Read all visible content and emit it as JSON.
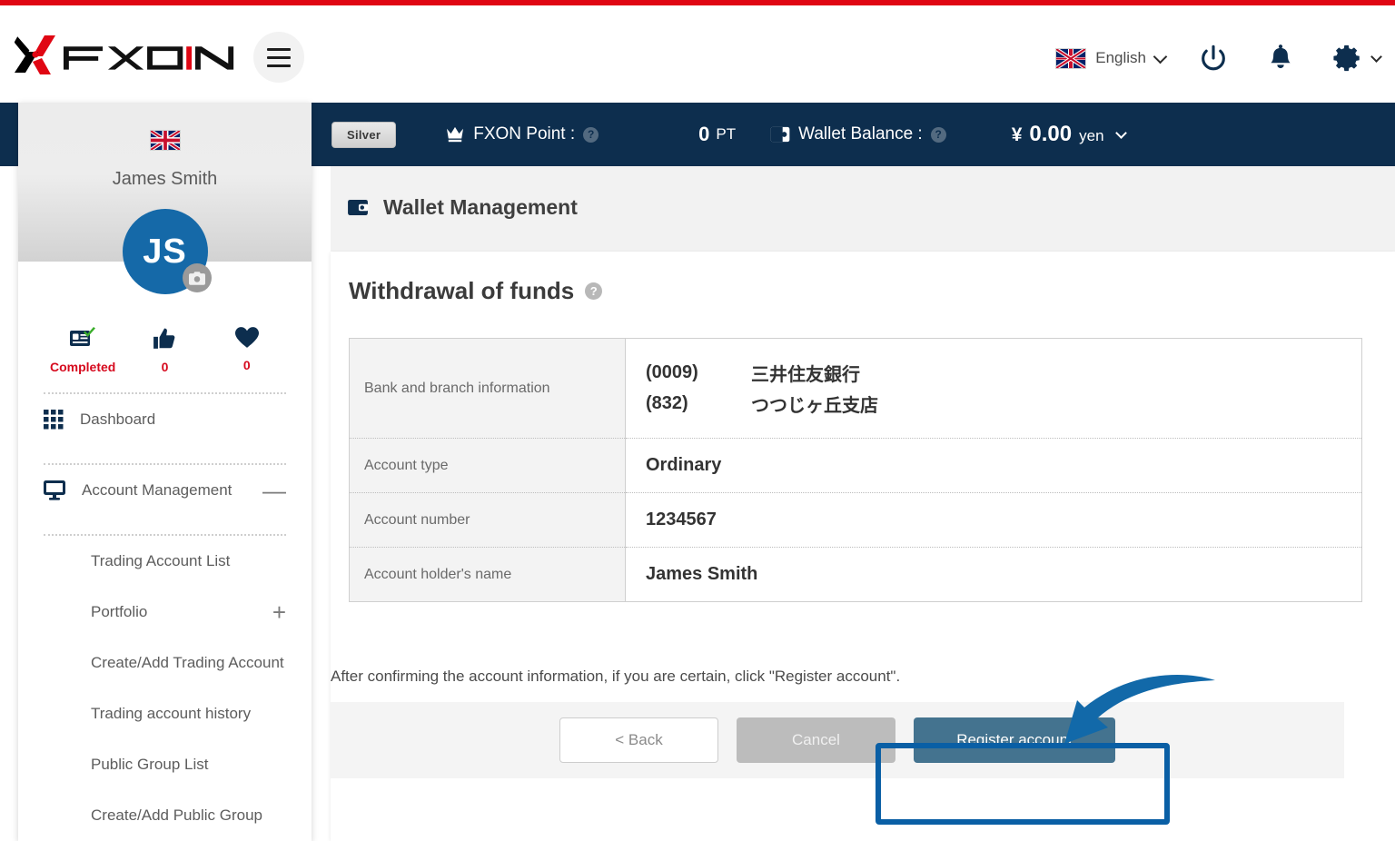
{
  "brand": {
    "logo_text": "FXON",
    "accent_red": "#e00613",
    "navy": "#0d2e4e"
  },
  "header": {
    "menu_icon": "hamburger-icon",
    "language": {
      "label": "English",
      "flag": "uk-flag-icon",
      "chevron": "chevron-down-icon"
    },
    "power_icon": "power-icon",
    "notification_icon": "bell-icon",
    "settings_icon": "gear-icon",
    "settings_chevron": "chevron-down-icon"
  },
  "status_bar": {
    "tier_badge": "Silver",
    "point_icon": "crown-icon",
    "point_label": "FXON Point :",
    "point_help": "?",
    "point_value": "0",
    "point_unit": "PT",
    "wallet_icon": "wallet-icon",
    "wallet_label": "Wallet Balance :",
    "wallet_help": "?",
    "currency_symbol": "¥",
    "balance_value": "0.00",
    "balance_unit": "yen",
    "balance_chevron": "chevron-down-icon"
  },
  "sidebar": {
    "flag": "uk-flag-icon",
    "user_name": "James Smith",
    "avatar_initials": "JS",
    "camera_icon": "camera-icon",
    "stats": [
      {
        "icon": "id-card-check-icon",
        "label": "Completed"
      },
      {
        "icon": "thumbs-up-icon",
        "label": "0"
      },
      {
        "icon": "heart-icon",
        "label": "0"
      }
    ],
    "nav": [
      {
        "icon": "grid-icon",
        "label": "Dashboard",
        "toggle": ""
      },
      {
        "icon": "monitor-icon",
        "label": "Account Management",
        "toggle": "—"
      }
    ],
    "sub_items": [
      {
        "label": "Trading Account List",
        "toggle": ""
      },
      {
        "label": "Portfolio",
        "toggle": "+"
      },
      {
        "label": "Create/Add Trading Account",
        "toggle": ""
      },
      {
        "label": "Trading account history",
        "toggle": ""
      },
      {
        "label": "Public Group List",
        "toggle": ""
      },
      {
        "label": "Create/Add Public Group",
        "toggle": ""
      }
    ]
  },
  "main": {
    "page_icon": "wallet-icon",
    "page_title": "Wallet Management",
    "section_title": "Withdrawal of funds",
    "section_help": "?",
    "table": {
      "rows": [
        {
          "label": "Bank and branch information",
          "type": "bank",
          "bank_code": "(0009)",
          "bank_name": "三井住友銀行",
          "branch_code": "(832)",
          "branch_name": "つつじヶ丘支店"
        },
        {
          "label": "Account type",
          "type": "text",
          "value": "Ordinary"
        },
        {
          "label": "Account number",
          "type": "text",
          "value": "1234567"
        },
        {
          "label": "Account holder's name",
          "type": "text",
          "value": "James Smith"
        }
      ]
    },
    "hint": "After confirming the account information, if you are certain, click \"Register account\".",
    "buttons": {
      "back": "< Back",
      "cancel": "Cancel",
      "register": "Register account"
    },
    "annotation": {
      "arrow": "curved-arrow-icon",
      "highlight_color": "#0a5fa5",
      "target": "Register account"
    }
  }
}
